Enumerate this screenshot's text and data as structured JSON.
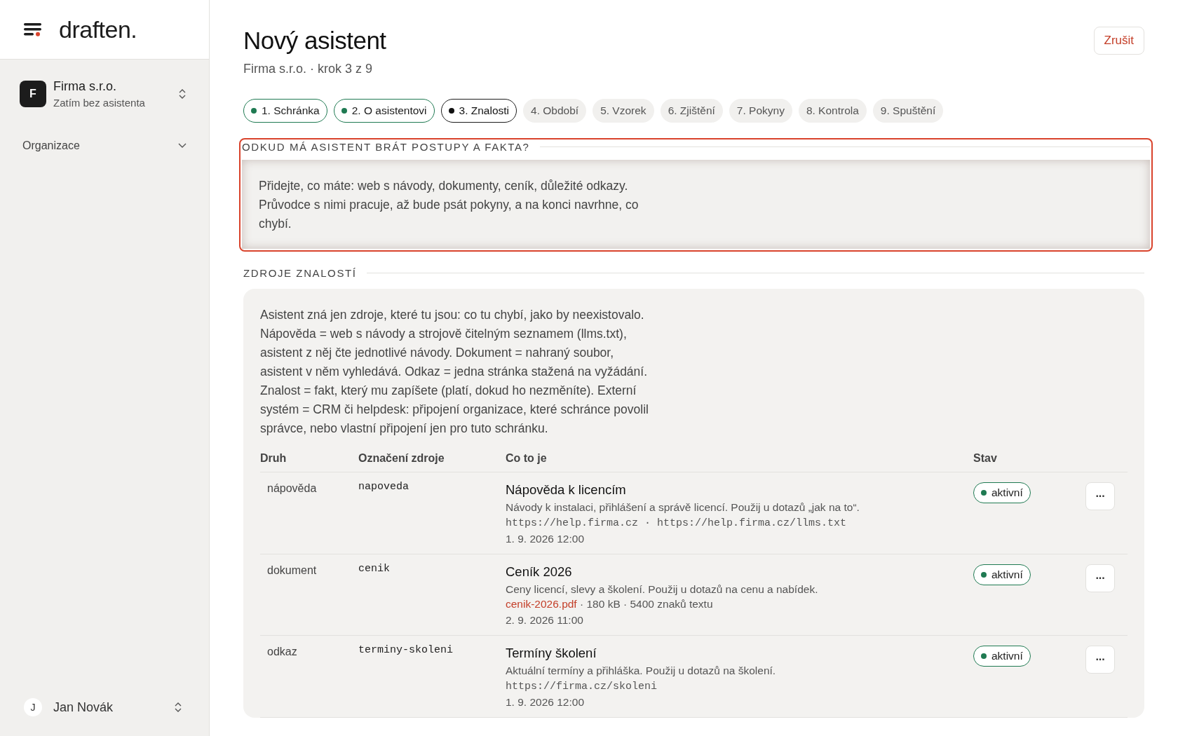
{
  "sidebar": {
    "logo": "draften.",
    "org": {
      "initial": "F",
      "name": "Firma s.r.o.",
      "subtitle": "Zatím bez asistenta"
    },
    "nav": [
      {
        "label": "Organizace",
        "expanded": false
      }
    ],
    "user": {
      "initial": "J",
      "name": "Jan Novák"
    }
  },
  "header": {
    "title": "Nový asistent",
    "subtitle": "Firma s.r.o. · krok 3 z 9",
    "cancel": "Zrušit"
  },
  "steps": [
    {
      "label": "1. Schránka",
      "kind": "done",
      "selected": false
    },
    {
      "label": "2. O asistentovi",
      "kind": "done",
      "selected": false
    },
    {
      "label": "3. Znalosti",
      "kind": "pending",
      "selected": true
    },
    {
      "label": "4. Období",
      "kind": "pending",
      "selected": false
    },
    {
      "label": "5. Vzorek",
      "kind": "pending",
      "selected": false
    },
    {
      "label": "6. Zjištění",
      "kind": "pending",
      "selected": false
    },
    {
      "label": "7. Pokyny",
      "kind": "pending",
      "selected": false
    },
    {
      "label": "8. Kontrola",
      "kind": "pending",
      "selected": false
    },
    {
      "label": "9. Spuštění",
      "kind": "pending",
      "selected": false
    }
  ],
  "intro": {
    "heading": "ODKUD MÁ ASISTENT BRÁT POSTUPY A FAKTA?",
    "highlighted": true,
    "text": "Přidejte, co máte: web s návody, dokumenty, ceník, důležité odkazy. Průvodce s nimi pracuje, až bude psát pokyny, a na konci navrhne, co chybí."
  },
  "sources": {
    "heading": "ZDROJE ZNALOSTÍ",
    "text": "Asistent zná jen zdroje, které tu jsou: co tu chybí, jako by neexistovalo. Nápověda = web s návody a strojově čitelným seznamem (llms.txt), asistent z něj čte jednotlivé návody. Dokument = nahraný soubor, asistent v něm vyhledává. Odkaz = jedna stránka stažená na vyžádání. Znalost = fakt, který mu zapíšete (platí, dokud ho nezměníte). Externí systém = CRM či helpdesk: připojení organizace, které schránce povolil správce, nebo vlastní připojení jen pro tuto schránku.",
    "table": {
      "columns": [
        "Druh",
        "Označení zdroje",
        "Co to je",
        "Stav"
      ],
      "rows": [
        {
          "kind": "nápověda",
          "slug": "napoveda",
          "title": "Nápověda k licencím",
          "description": "Návody k instalaci, přihlášení a správě licencí. Použij u dotazů „jak na to“.",
          "details": [
            {
              "kind": "url",
              "text": "https://help.firma.cz · https://help.firma.cz/llms.txt"
            }
          ],
          "date": "1. 9. 2026 12:00",
          "status": "aktivní",
          "active": true,
          "menu": "···"
        },
        {
          "kind": "dokument",
          "slug": "cenik",
          "title": "Ceník 2026",
          "description": "Ceny licencí, slevy a školení. Použij u dotazů na cenu a nabídek.",
          "details": [
            {
              "kind": "file",
              "text": "cenik-2026.pdf"
            },
            {
              "kind": "meta",
              "text": " · 180 kB · 5400 znaků textu"
            }
          ],
          "date": "2. 9. 2026 11:00",
          "status": "aktivní",
          "active": true,
          "menu": "···"
        },
        {
          "kind": "odkaz",
          "slug": "terminy-skoleni",
          "title": "Termíny školení",
          "description": "Aktuální termíny a přihláška. Použij u dotazů na školení.",
          "details": [
            {
              "kind": "url",
              "text": "https://firma.cz/skoleni"
            }
          ],
          "date": "1. 9. 2026 12:00",
          "status": "aktivní",
          "active": true,
          "menu": "···"
        }
      ]
    }
  }
}
